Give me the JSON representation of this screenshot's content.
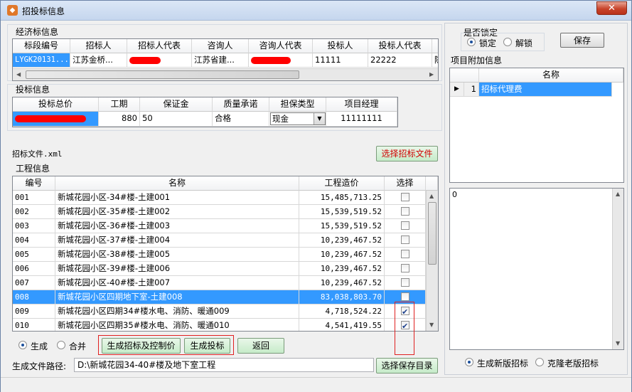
{
  "window": {
    "title": "招投标信息",
    "close_label": "✕"
  },
  "econ_section": {
    "title": "经济标信息"
  },
  "econ_table": {
    "headers": [
      "标段编号",
      "招标人",
      "招标人代表",
      "咨询人",
      "咨询人代表",
      "投标人",
      "投标人代表"
    ],
    "row": [
      "LYGK20131...",
      "江苏金桥...",
      "",
      "江苏省建...",
      "",
      "11111",
      "22222",
      "陈"
    ]
  },
  "bid_section": {
    "title": "投标信息"
  },
  "bid_table": {
    "headers": [
      "投标总价",
      "工期",
      "保证金",
      "质量承诺",
      "担保类型",
      "项目经理"
    ],
    "row": [
      "",
      "880",
      "50",
      "合格",
      "现金",
      "11111111"
    ]
  },
  "file": {
    "label": "招标文件.xml",
    "select_button": "选择招标文件"
  },
  "project_section": {
    "title": "工程信息"
  },
  "project_table": {
    "headers": [
      "编号",
      "名称",
      "工程造价",
      "选择"
    ],
    "rows": [
      {
        "id": "001",
        "name": "新城花园小区-34#楼-土建001",
        "cost": "15,485,713.25",
        "checked": false
      },
      {
        "id": "002",
        "name": "新城花园小区-35#楼-土建002",
        "cost": "15,539,519.52",
        "checked": false
      },
      {
        "id": "003",
        "name": "新城花园小区-36#楼-土建003",
        "cost": "15,539,519.52",
        "checked": false
      },
      {
        "id": "004",
        "name": "新城花园小区-37#楼-土建004",
        "cost": "10,239,467.52",
        "checked": false
      },
      {
        "id": "005",
        "name": "新城花园小区-38#楼-土建005",
        "cost": "10,239,467.52",
        "checked": false
      },
      {
        "id": "006",
        "name": "新城花园小区-39#楼-土建006",
        "cost": "10,239,467.52",
        "checked": false
      },
      {
        "id": "007",
        "name": "新城花园小区-40#楼-土建007",
        "cost": "10,239,467.52",
        "checked": false
      },
      {
        "id": "008",
        "name": "新城花园小区四期地下室-土建008",
        "cost": "83,038,803.70",
        "checked": false,
        "selected": true
      },
      {
        "id": "009",
        "name": "新城花园小区四期34#楼水电、消防、暖通009",
        "cost": "4,718,524.22",
        "checked": true
      },
      {
        "id": "010",
        "name": "新城花园小区四期35#楼水电、消防、暖通010",
        "cost": "4,541,419.55",
        "checked": true
      }
    ]
  },
  "mode": {
    "generate": "生成",
    "merge": "合并"
  },
  "actions": {
    "gen_bid_control": "生成招标及控制价",
    "gen_tender": "生成投标",
    "back": "返回"
  },
  "output": {
    "label": "生成文件路径:",
    "path": "D:\\新城花园34-40#楼及地下室工程",
    "choose_dir": "选择保存目录"
  },
  "lock": {
    "title": "是否锁定",
    "locked": "锁定",
    "unlocked": "解锁",
    "save": "保存"
  },
  "extra_section": {
    "title": "项目附加信息",
    "header": "名称",
    "rows": [
      {
        "num": "1",
        "name": "招标代理费"
      }
    ]
  },
  "memo": {
    "value": "0"
  },
  "version": {
    "new": "生成新版招标",
    "old": "克隆老版招标"
  },
  "colors": {
    "selection": "#3399ff",
    "highlight_box": "#e02020",
    "green_button": "#c6ebc9"
  }
}
